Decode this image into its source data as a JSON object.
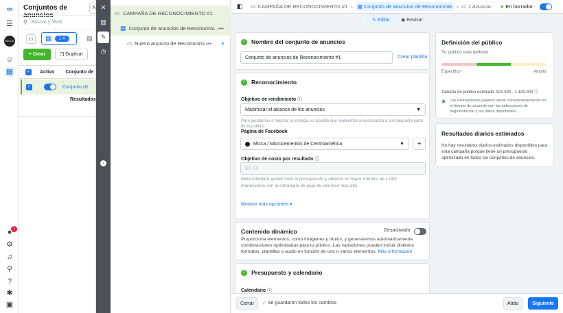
{
  "rail": {
    "notification_count": "1"
  },
  "left_pane": {
    "title": "Conjuntos de anuncios",
    "new_button_fragment": "N",
    "search_placeholder": "Buscar y filtrar",
    "filter_count": "1",
    "create_label": "Crear",
    "duplicate_label": "Duplicar",
    "col_active": "Activo",
    "col_name": "Conjunto de",
    "row_name": "Conjunto de",
    "results_label": "Resultados"
  },
  "tree": {
    "campaign": "CAMPAÑA DE RECONOCIMIENTO #1",
    "adset": "Conjunto de anuncios de Reconocimi...",
    "ad": "Nuevo anuncio de Reconocimi..."
  },
  "topbar": {
    "crumb_campaign": "CAMPAÑA DE RECONOCIMIENTO #1",
    "crumb_adset": "Conjunto de anuncios de Reconocimie",
    "crumb_ad": "1 Anuncio",
    "status": "En borrador",
    "edit_label": "Editar",
    "review_label": "Revisar"
  },
  "name_card": {
    "title": "Nombre del conjunto de anuncios",
    "value": "Conjunto de anuncios de Reconocimiento #1",
    "template_link": "Crear plantilla"
  },
  "recognition_card": {
    "title": "Reconocimiento",
    "goal_label": "Objetivo de rendimiento",
    "goal_value": "Maximizar el alcance de los anuncios",
    "goal_help": "Para ayudarnos a mejorar la entrega, es posible que realicemos una encuesta a una pequeña parte de tu público.",
    "page_label": "Página de Facebook",
    "page_value": "Micca / Microcementos de Centroamérica",
    "cost_label": "Objetivo de costo por resultado",
    "cost_placeholder": "$X.XX",
    "cost_help": "Meta intentará gastar todo el presupuesto y obtener el mayor número de 1.000 impresiones con la estrategia de puja de volumen más alto.",
    "more_options": "Mostrar más opciones"
  },
  "dynamic_card": {
    "title": "Contenido dinámico",
    "status": "Desactivado",
    "desc": "Proporciona elementos, como imágenes y títulos, y generaremos automáticamente combinaciones optimizadas para tu público. Las variaciones pueden incluir distintos formatos, plantillas o audio en función de uno o varios elementos.",
    "more_info": "Más información"
  },
  "budget_card": {
    "title": "Presupuesto y calendario",
    "calendar_label": "Calendario"
  },
  "audience_card": {
    "title": "Definición del público",
    "subtitle": "Tu público está definido.",
    "specific": "Específico",
    "broad": "Amplio",
    "size": "Tamaño de público estimado: 921.900 - 1.100.000",
    "note": "Las estimaciones pueden variar considerablemente en el tiempo de acuerdo con las selecciones de segmentación y los datos disponibles."
  },
  "results_card": {
    "title": "Resultados diarios estimados",
    "text": "No hay resultados diarios estimados disponibles para esta campaña porque tiene un presupuesto optimizado en todos los conjuntos de anuncios."
  },
  "footer": {
    "close_label": "Cerrar",
    "saved_text": "Se guardaron todos los cambios",
    "back_label": "Atrás",
    "next_label": "Siguiente"
  },
  "colors": {
    "brand_blue": "#1877f2",
    "success_green": "#42b72a",
    "dark_rail": "#4b4f56"
  }
}
